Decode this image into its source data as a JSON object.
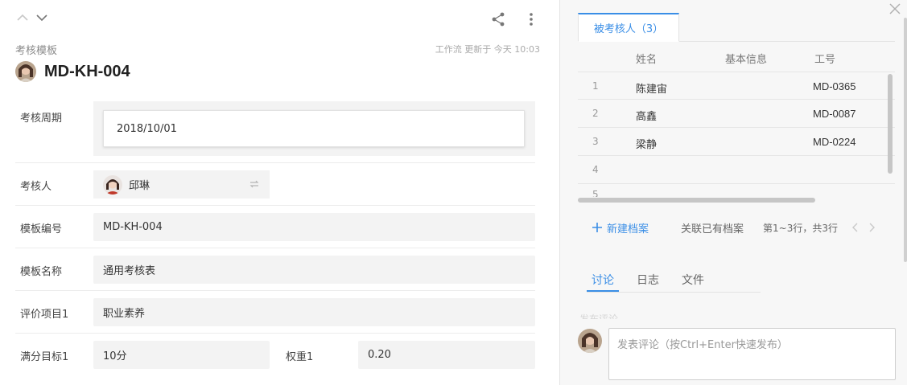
{
  "header": {
    "subtitle": "考核模板",
    "meta": "工作流 更新于 今天 10:03",
    "title": "MD-KH-004"
  },
  "form": {
    "period": {
      "label": "考核周期",
      "value": "2018/10/01"
    },
    "assessor": {
      "label": "考核人",
      "value": "邱琳"
    },
    "template_no": {
      "label": "模板编号",
      "value": "MD-KH-004"
    },
    "template_name": {
      "label": "模板名称",
      "value": "通用考核表"
    },
    "item1": {
      "label": "评价项目1",
      "value": "职业素养"
    },
    "target1": {
      "label": "满分目标1",
      "value": "10分"
    },
    "weight1": {
      "label": "权重1",
      "value": "0.20"
    }
  },
  "right": {
    "tab_label": "被考核人（3）",
    "columns": [
      "姓名",
      "基本信息",
      "工号"
    ],
    "rows": [
      {
        "idx": "1",
        "name": "陈建宙",
        "code": "MD-0365"
      },
      {
        "idx": "2",
        "name": "高鑫",
        "code": "MD-0087"
      },
      {
        "idx": "3",
        "name": "梁静",
        "code": "MD-0224"
      },
      {
        "idx": "4",
        "name": "",
        "code": ""
      }
    ],
    "partial_row_idx": "5",
    "new_label": "新建档案",
    "link_label": "关联已有档案",
    "pager": "第1~3行，共3行",
    "discussion_tabs": [
      "讨论",
      "日志",
      "文件"
    ],
    "faded_text": "发布评论",
    "comment_placeholder": "发表评论（按Ctrl+Enter快速发布）"
  },
  "colors": {
    "accent": "#3a8ee6"
  }
}
